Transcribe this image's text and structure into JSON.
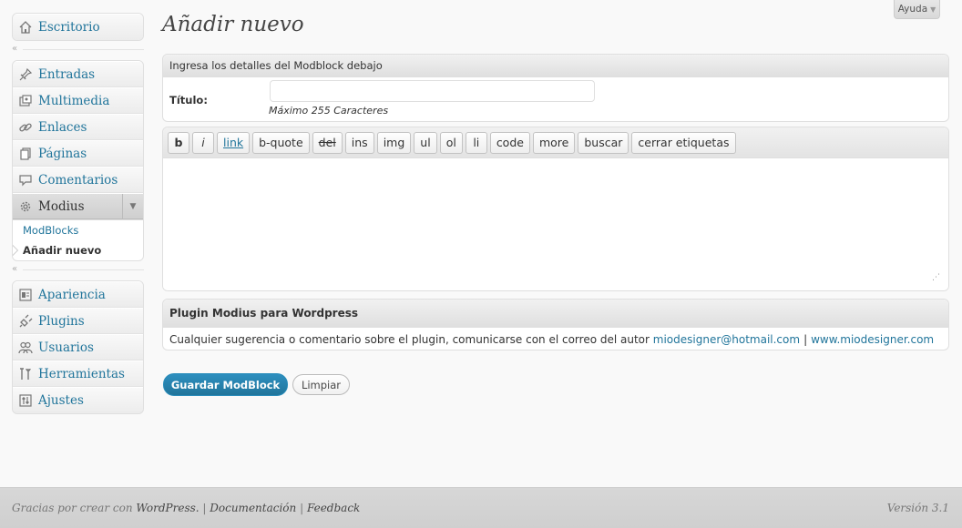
{
  "sidebar": {
    "group1": [
      {
        "label": "Escritorio",
        "icon": "dashboard-icon"
      }
    ],
    "group2": [
      {
        "label": "Entradas",
        "icon": "pin-icon"
      },
      {
        "label": "Multimedia",
        "icon": "media-icon"
      },
      {
        "label": "Enlaces",
        "icon": "link-icon"
      },
      {
        "label": "Páginas",
        "icon": "pages-icon"
      },
      {
        "label": "Comentarios",
        "icon": "comment-icon"
      },
      {
        "label": "Modius",
        "icon": "gear-icon"
      }
    ],
    "submenu": [
      {
        "label": "ModBlocks"
      },
      {
        "label": "Añadir nuevo"
      }
    ],
    "group3": [
      {
        "label": "Apariencia",
        "icon": "appearance-icon"
      },
      {
        "label": "Plugins",
        "icon": "plugin-icon"
      },
      {
        "label": "Usuarios",
        "icon": "users-icon"
      },
      {
        "label": "Herramientas",
        "icon": "tools-icon"
      },
      {
        "label": "Ajustes",
        "icon": "settings-icon"
      }
    ],
    "separator_glyph": "«"
  },
  "help": {
    "label": "Ayuda",
    "caret": "▼"
  },
  "page": {
    "title": "Añadir nuevo"
  },
  "details": {
    "header": "Ingresa los detalles del Modblock debajo",
    "title_label": "Título:",
    "title_value": "",
    "title_hint": "Máximo 255 Caracteres"
  },
  "editor": {
    "buttons": [
      "b",
      "i",
      "link",
      "b-quote",
      "del",
      "ins",
      "img",
      "ul",
      "ol",
      "li",
      "code",
      "more",
      "buscar",
      "cerrar etiquetas"
    ],
    "content": ""
  },
  "plugin_info": {
    "header": "Plugin Modius para Wordpress",
    "text": "Cualquier sugerencia o comentario sobre el plugin, comunicarse con el correo del autor ",
    "email": "miodesigner@hotmail.com",
    "separator": "|",
    "website": "www.miodesigner.com"
  },
  "actions": {
    "save_label": "Guardar ModBlock",
    "clear_label": "Limpiar"
  },
  "footer": {
    "thanks_prefix": "Gracias por crear con ",
    "wordpress": "WordPress.",
    "sep": " | ",
    "docs": "Documentación",
    "feedback": "Feedback",
    "version": "Versión 3.1"
  },
  "colors": {
    "accent": "#21759b",
    "primary_button": "#21759b",
    "footer_bg": "#d7d7d7"
  }
}
